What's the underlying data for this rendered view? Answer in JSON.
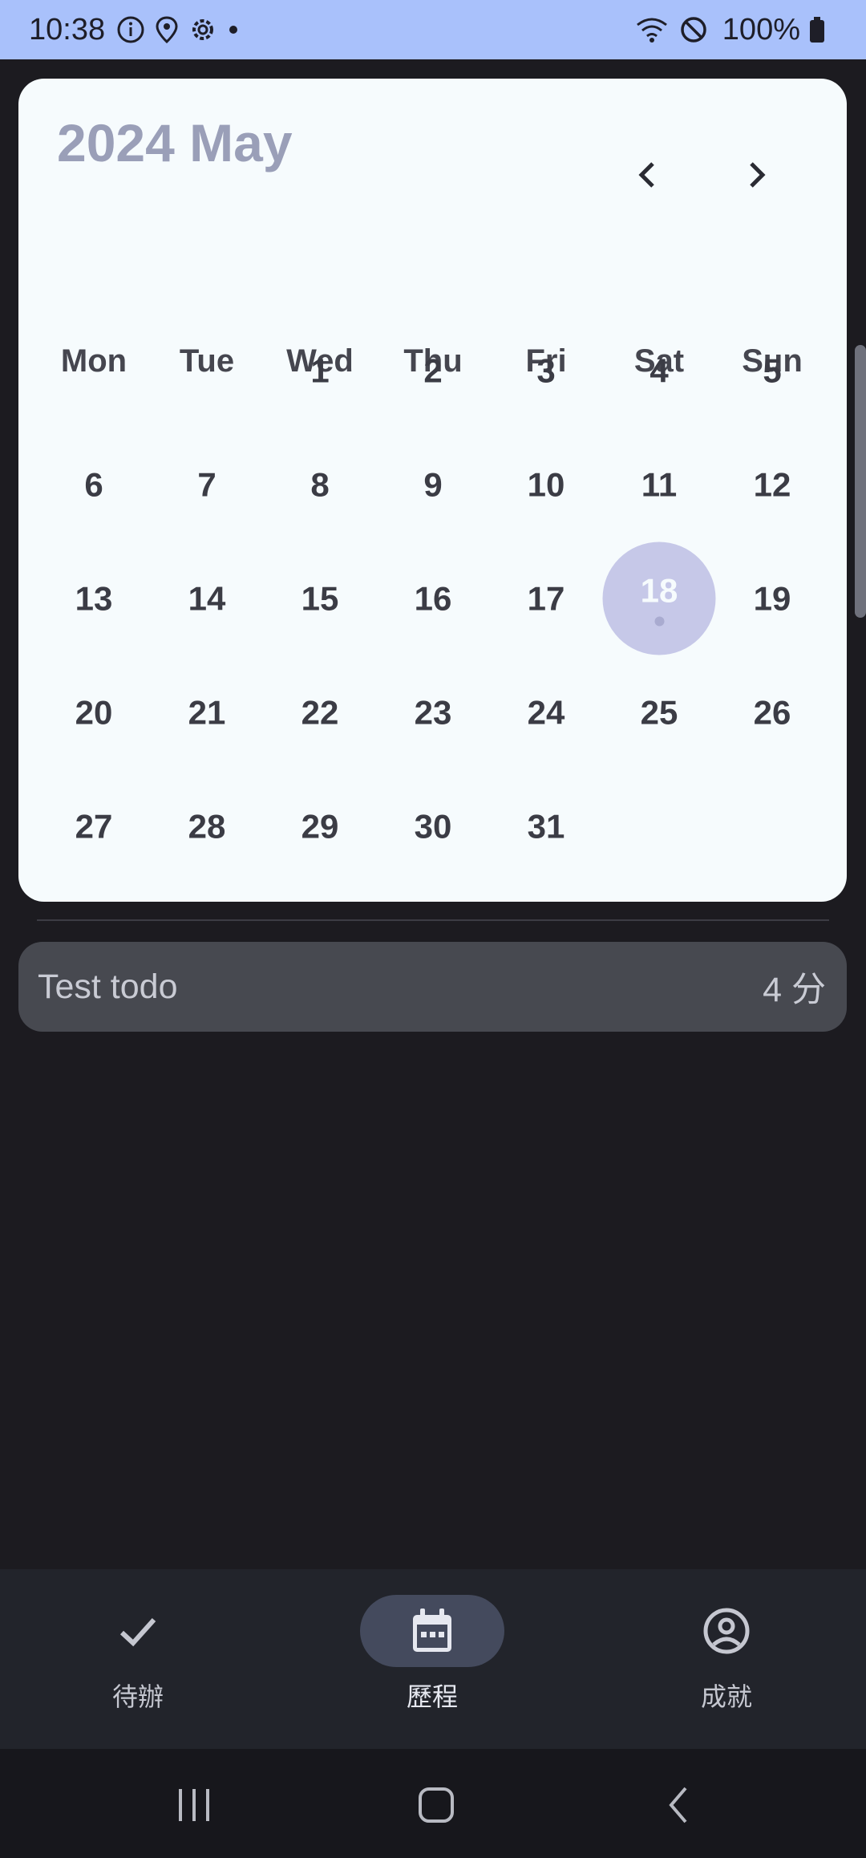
{
  "status_bar": {
    "time": "10:38",
    "battery": "100%",
    "icons": [
      "info-icon",
      "location-icon",
      "settings-icon",
      "dot-icon",
      "wifi-icon",
      "dnd-icon",
      "battery-icon"
    ]
  },
  "calendar": {
    "title": "2024 May",
    "weekdays": [
      "Mon",
      "Tue",
      "Wed",
      "Thu",
      "Fri",
      "Sat",
      "Sun"
    ],
    "weeks": [
      [
        "",
        "",
        "1",
        "2",
        "3",
        "4",
        "5"
      ],
      [
        "6",
        "7",
        "8",
        "9",
        "10",
        "11",
        "12"
      ],
      [
        "13",
        "14",
        "15",
        "16",
        "17",
        "18",
        "19"
      ],
      [
        "20",
        "21",
        "22",
        "23",
        "24",
        "25",
        "26"
      ],
      [
        "27",
        "28",
        "29",
        "30",
        "31",
        "",
        ""
      ]
    ],
    "selected_day": "18",
    "accent_color": "#c6c8e8"
  },
  "todo": {
    "title": "Test todo",
    "points": "4 分"
  },
  "bottom_nav": {
    "items": [
      {
        "label": "待辦",
        "icon": "check-icon",
        "active": false
      },
      {
        "label": "歷程",
        "icon": "calendar-icon",
        "active": true
      },
      {
        "label": "成就",
        "icon": "account-circle-icon",
        "active": false
      }
    ]
  },
  "system_nav": [
    "recents-icon",
    "home-icon",
    "back-icon"
  ]
}
